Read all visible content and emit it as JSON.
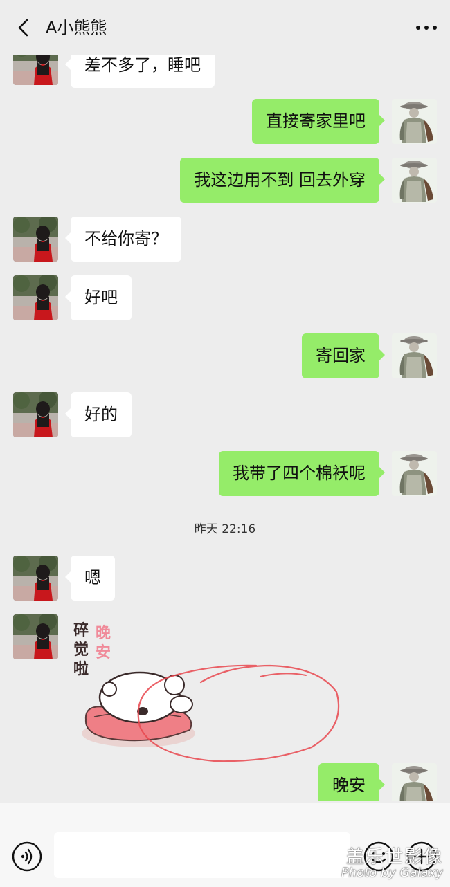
{
  "header": {
    "title": "A小熊熊",
    "back_icon": "chevron-left-icon",
    "more_icon": "more-dots-icon"
  },
  "messages": [
    {
      "side": "left",
      "text": "差不多了，睡吧"
    },
    {
      "side": "right",
      "text": "直接寄家里吧"
    },
    {
      "side": "right",
      "text": "我这边用不到  回去外穿"
    },
    {
      "side": "left",
      "text": "不给你寄？"
    },
    {
      "side": "left",
      "text": "好吧"
    },
    {
      "side": "right",
      "text": "寄回家"
    },
    {
      "side": "left",
      "text": "好的"
    },
    {
      "side": "right",
      "text": "我带了四个棉袄呢"
    },
    {
      "side": "left",
      "text": "嗯"
    },
    {
      "side": "right",
      "text": "晚安"
    }
  ],
  "timestamp": "昨天 22:16",
  "sticker": {
    "line1": "碎",
    "line2": "觉",
    "line3": "啦",
    "pink1": "晚",
    "pink2": "安"
  },
  "footer": {
    "voice_icon": "voice-icon",
    "emoji_icon": "emoji-icon",
    "plus_icon": "plus-icon"
  },
  "watermark": {
    "line1": "盖乐世影像",
    "line2": "Photo by Galaxy"
  },
  "colors": {
    "background": "#ededed",
    "bubble_self": "#95ec69",
    "bubble_other": "#ffffff",
    "annotation": "#e8474d"
  }
}
